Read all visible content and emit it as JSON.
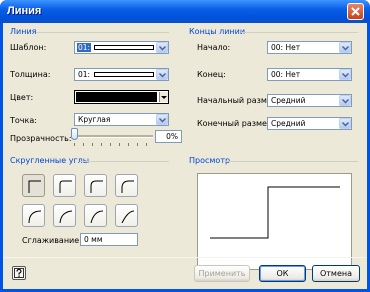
{
  "window": {
    "title": "Линия"
  },
  "line": {
    "section": "Линия",
    "pattern_label": "Шаблон:",
    "pattern_value": "01:",
    "weight_label": "Толщина:",
    "weight_value": "01:",
    "color_label": "Цвет:",
    "cap_label": "Точка:",
    "cap_value": "Круглая",
    "transparency_label": "Прозрачность:",
    "transparency_value": "0%"
  },
  "line_ends": {
    "section": "Концы линии",
    "begin_label": "Начало:",
    "begin_value": "00: Нет",
    "end_label": "Конец:",
    "end_value": "00: Нет",
    "begin_size_label": "Начальный размер:",
    "begin_size_value": "Средний",
    "end_size_label": "Конечный размер:",
    "end_size_value": "Средний"
  },
  "rounding": {
    "section": "Скругленные углы",
    "smoothing_label": "Сглаживание:",
    "smoothing_value": "0 мм"
  },
  "preview": {
    "section": "Просмотр"
  },
  "buttons": {
    "apply": "Применить",
    "ok": "ОК",
    "cancel": "Отмена"
  },
  "colors": {
    "title_bar": "#0054e3",
    "section_header": "#0046d5",
    "dialog_bg": "#ece9d8",
    "selection": "#316ac5"
  }
}
